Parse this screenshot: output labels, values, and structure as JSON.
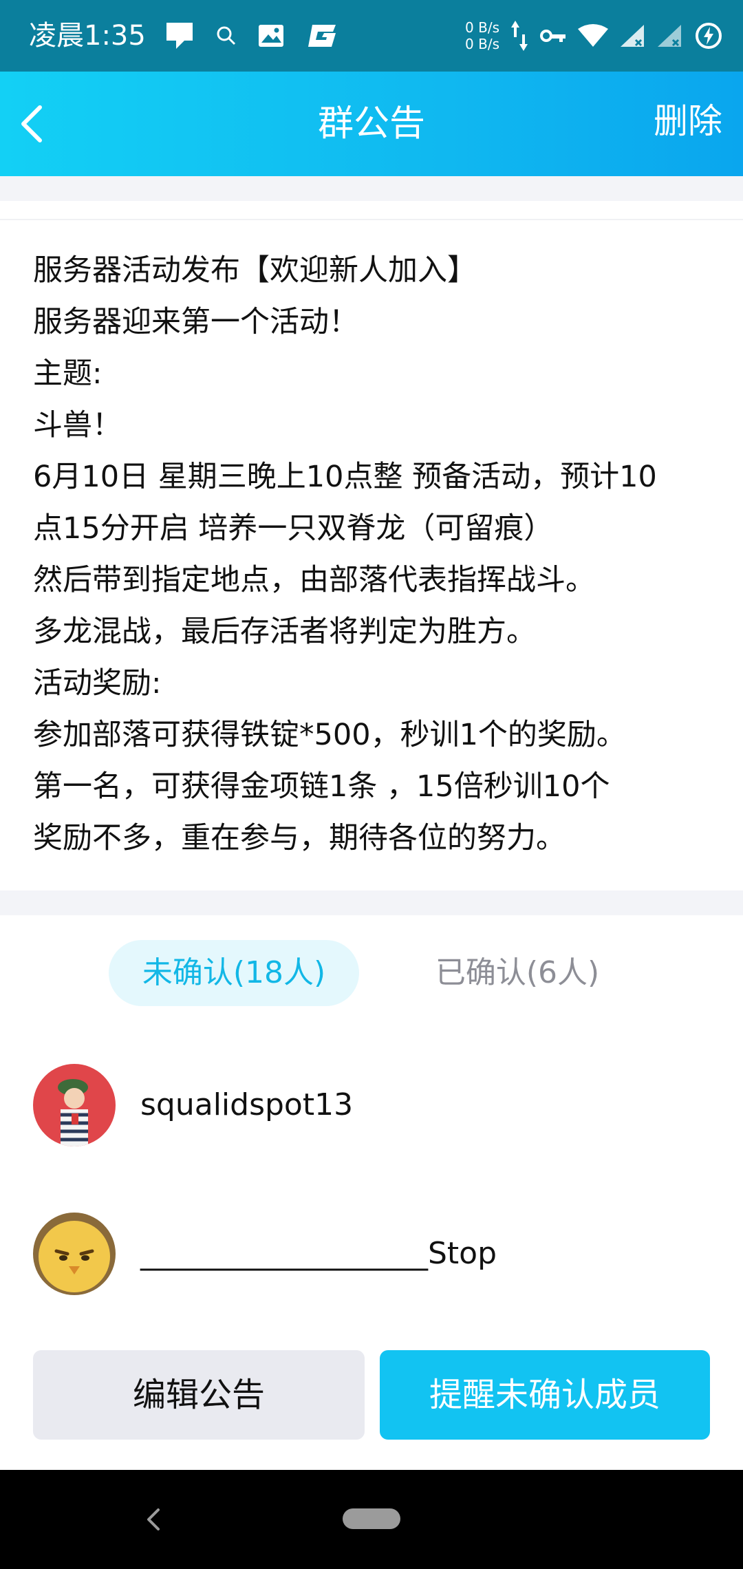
{
  "status_bar": {
    "time": "凌晨1:35",
    "net_speed_up": "0 B/s",
    "net_speed_down": "0 B/s"
  },
  "header": {
    "title": "群公告",
    "delete_label": "删除"
  },
  "announcement": {
    "lines": [
      "服务器活动发布【欢迎新人加入】",
      "服务器迎来第一个活动！",
      "主题:",
      "斗兽！",
      "6月10日 星期三晚上10点整 预备活动，预计10",
      "点15分开启 培养一只双脊龙（可留痕）",
      "然后带到指定地点，由部落代表指挥战斗。",
      "多龙混战，最后存活者将判定为胜方。",
      "活动奖励:",
      "参加部落可获得铁锭*500，秒训1个的奖励。",
      "第一名，可获得金项链1条 ，15倍秒训10个",
      "奖励不多，重在参与，期待各位的努力。"
    ]
  },
  "tabs": {
    "unconfirmed": "未确认(18人)",
    "confirmed": "已确认(6人)"
  },
  "members": [
    {
      "name": "squalidspot13",
      "avatar": "cartoon-girl-red-avatar"
    },
    {
      "name": "___________________Stop",
      "avatar": "yellow-chick-avatar"
    }
  ],
  "buttons": {
    "edit": "编辑公告",
    "remind": "提醒未确认成员"
  },
  "colors": {
    "accent": "#12c3f2",
    "status_bar": "#0b7f9d",
    "tab_active_bg": "#e4f8fd",
    "tab_active_text": "#12b7e6"
  }
}
